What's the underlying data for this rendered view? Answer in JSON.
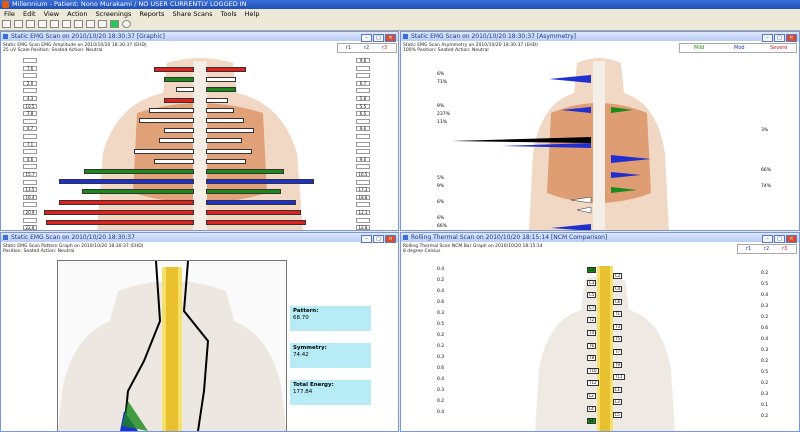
{
  "app": {
    "title": "Millennium - Patient: Nono Murakami / NO USER CURRENTLY LOGGED IN"
  },
  "menu": [
    "File",
    "Edit",
    "View",
    "Action",
    "Screenings",
    "Reports",
    "Share Scans",
    "Tools",
    "Help"
  ],
  "panels": {
    "p1": {
      "title": "Static EMG Scan on 2010/10/20 18:30:37 [Graphic]",
      "sub1": "Static EMG Scan EMG Amplitude on 2010/10/20 18:30:37 (EHD)",
      "sub2": "25 uV Scale     Position: Seated     Action: Neutral",
      "legend": [
        "r1",
        "r2",
        "r3"
      ],
      "left_labels": [
        "",
        "7.6",
        "",
        "2.0",
        "",
        "4.3",
        "10.5",
        "7.8",
        "",
        "4.7",
        "",
        "7.1",
        "",
        "4.6",
        "",
        "15.7",
        "",
        "13.5",
        "16.4",
        "",
        "20.9",
        "",
        "22.8",
        "22.6"
      ],
      "right_labels": [
        "9.6",
        "",
        "",
        "6.7",
        "",
        "5.8",
        "5.5",
        "6.5",
        "",
        "9.6",
        "",
        "",
        "",
        "9.0",
        "",
        "16.5",
        "",
        "17.3",
        "18.8",
        "",
        "12.1",
        "",
        "12.8",
        "10.4"
      ],
      "spine_labels": [
        "C1",
        "C3",
        "C5",
        "C7",
        "T1",
        "T2",
        "T3",
        "T4",
        "T5",
        "T6",
        "T7",
        "T8",
        "T9",
        "T10",
        "T11",
        "T12",
        "L1",
        "L2",
        "L3",
        "L4",
        "L5",
        "S1"
      ]
    },
    "p2": {
      "title": "Static EMG Scan on 2010/10/20 18:30:37 [Asymmetry]",
      "sub1": "Static EMG Scan Asymmetry on 2010/10/20 18:30:37 (EHD)",
      "sub2": "100%     Position: Seated     Action: Neutral",
      "legend": [
        "Mild",
        "Mod",
        "Severe"
      ],
      "left_labels": [
        "6%",
        "71%",
        "",
        "",
        "9%",
        "237%",
        "11%",
        "",
        "",
        "",
        "",
        "",
        "",
        "5%",
        "9%",
        "",
        "6%",
        "",
        "6%",
        "66%"
      ],
      "right_labels": [
        "",
        "",
        "",
        "",
        "",
        "",
        "",
        "3%",
        "",
        "",
        "",
        "",
        "66%",
        "",
        "74%",
        "",
        "",
        "",
        "",
        "",
        "3%",
        ""
      ]
    },
    "p3": {
      "title": "Static EMG Scan on 2010/10/20 18:30:37",
      "sub1": "Static EMG Scan Pattern Graph on 2010/10/20 18:30:37 (EHD)",
      "sub2": "Position: Seated     Action: Neutral",
      "pattern_label": "Pattern:",
      "pattern_value": "68.70",
      "symmetry_label": "Symmetry:",
      "symmetry_value": "74.42",
      "energy_label": "Total Energy:",
      "energy_value": "177.84"
    },
    "p4": {
      "title": "Rolling Thermal Scan on 2010/10/20 18:15:14 [NCM Comparison]",
      "sub1": "Rolling Thermal Scan NCM Bar Graph on 2010/10/20 18:15:14",
      "sub2": "8 degree Celsius",
      "legend": [
        "r1",
        "r2",
        "r3"
      ],
      "left_labels": [
        "0.4",
        "0.2",
        "0.4",
        "0.6",
        "0.3",
        "0.5",
        "0.2",
        "0.2",
        "0.3",
        "0.6",
        "0.4",
        "0.3",
        "0.2",
        "0.4"
      ],
      "right_labels": [
        "0.2",
        "0.5",
        "0.4",
        "0.3",
        "0.2",
        "0.6",
        "0.4",
        "0.3",
        "0.2",
        "0.5",
        "0.2",
        "0.3",
        "0.1",
        "0.2"
      ],
      "vert_labels": [
        "C1",
        "C2",
        "C3",
        "C4",
        "C5",
        "C6",
        "C7",
        "T1",
        "T2",
        "T3",
        "T4",
        "T5",
        "T6",
        "T7",
        "T8",
        "T9",
        "T10",
        "T11",
        "T12",
        "L1",
        "L2",
        "L3",
        "L4",
        "L5",
        "S1"
      ]
    }
  },
  "colors": {
    "red": "#e3201b",
    "green": "#1a8a1a",
    "blue": "#1f2fd0",
    "white": "#ffffff"
  },
  "emg_bars": [
    {
      "row": 0,
      "lw": 40,
      "lc": "red",
      "rw": 40,
      "rc": "red"
    },
    {
      "row": 1,
      "lw": 30,
      "lc": "green",
      "rw": 30,
      "rc": "white"
    },
    {
      "row": 2,
      "lw": 18,
      "lc": "white",
      "rw": 30,
      "rc": "green"
    },
    {
      "row": 3,
      "lw": 30,
      "lc": "red",
      "rw": 22,
      "rc": "white"
    },
    {
      "row": 4,
      "lw": 45,
      "lc": "white",
      "rw": 28,
      "rc": "white"
    },
    {
      "row": 5,
      "lw": 55,
      "lc": "white",
      "rw": 38,
      "rc": "white"
    },
    {
      "row": 6,
      "lw": 30,
      "lc": "white",
      "rw": 48,
      "rc": "white"
    },
    {
      "row": 7,
      "lw": 35,
      "lc": "white",
      "rw": 36,
      "rc": "white"
    },
    {
      "row": 8,
      "lw": 60,
      "lc": "white",
      "rw": 46,
      "rc": "white"
    },
    {
      "row": 9,
      "lw": 40,
      "lc": "white",
      "rw": 40,
      "rc": "white"
    },
    {
      "row": 10,
      "lw": 110,
      "lc": "green",
      "rw": 78,
      "rc": "green"
    },
    {
      "row": 11,
      "lw": 135,
      "lc": "blue",
      "rw": 108,
      "rc": "blue"
    },
    {
      "row": 12,
      "lw": 112,
      "lc": "green",
      "rw": 75,
      "rc": "green"
    },
    {
      "row": 13,
      "lw": 135,
      "lc": "red",
      "rw": 90,
      "rc": "blue"
    },
    {
      "row": 14,
      "lw": 150,
      "lc": "red",
      "rw": 95,
      "rc": "red"
    },
    {
      "row": 15,
      "lw": 148,
      "lc": "red",
      "rw": 100,
      "rc": "red"
    }
  ]
}
